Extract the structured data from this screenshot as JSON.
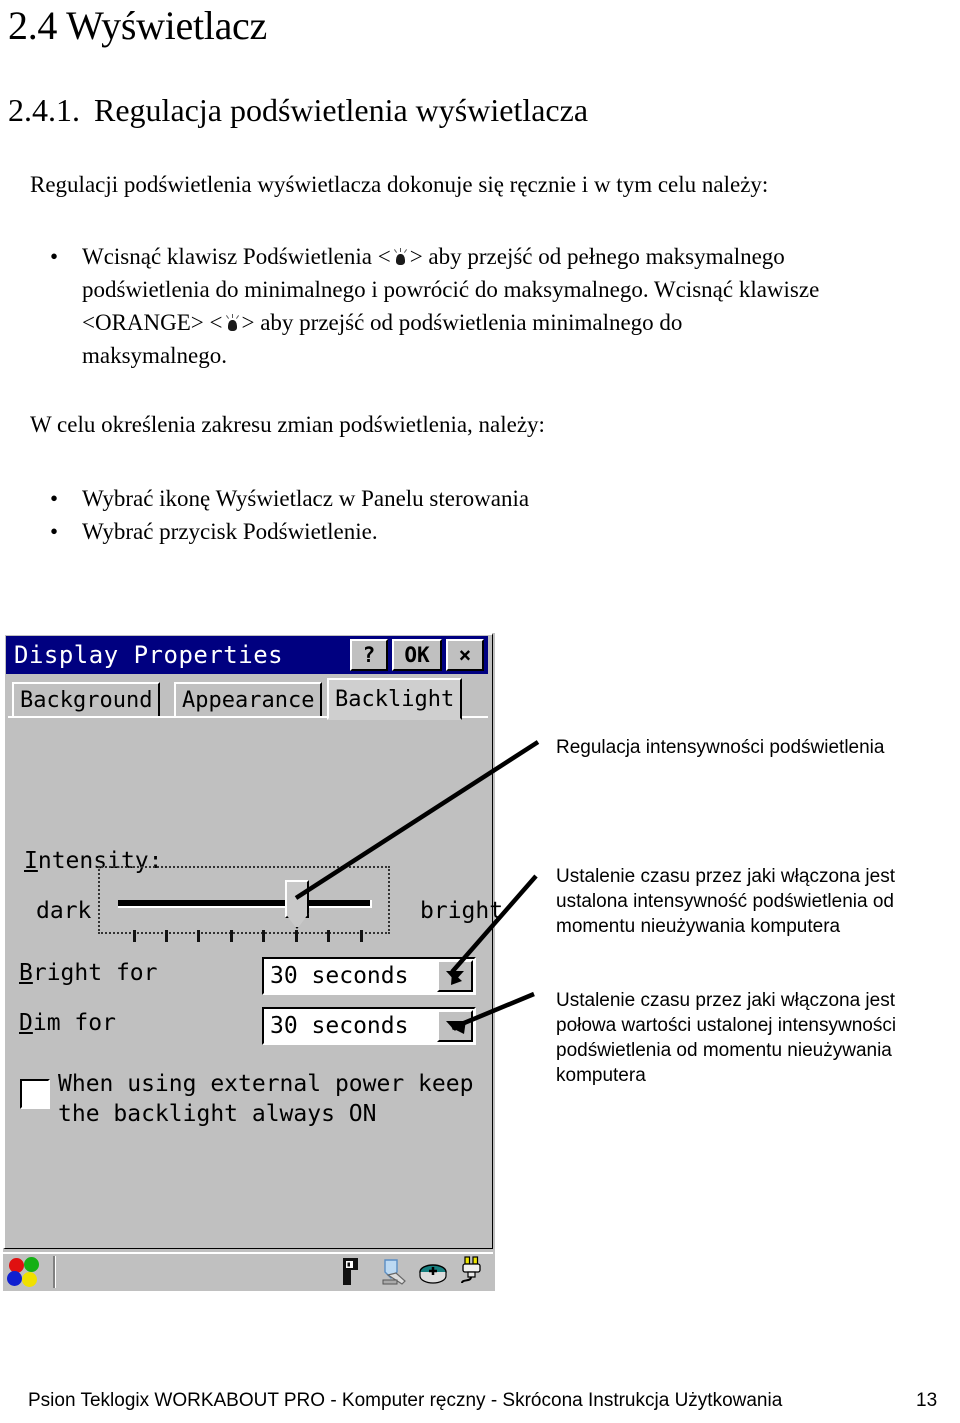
{
  "document": {
    "heading_1": "2.4 Wyświetlacz",
    "heading_2_number": "2.4.1.",
    "heading_2_text": "Regulacja podświetlenia wyświetlacza",
    "intro_paragraph": "Regulacji podświetlenia wyświetlacza dokonuje się ręcznie i w tym celu należy:",
    "bullet_1_part_a": "Wcisnąć klawisz Podświetlenia <",
    "bullet_1_part_b": "> aby przejść od pełnego maksymalnego",
    "bullet_1_line_2": "podświetlenia do minimalnego i powrócić do maksymalnego. Wcisnąć klawisze",
    "bullet_1_line_3_a": "<ORANGE> <",
    "bullet_1_line_3_b": "> aby przejść od podświetlenia minimalnego do",
    "bullet_1_line_4": "maksymalnego.",
    "paragraph_2": "W celu określenia zakresu zmian podświetlenia, należy:",
    "bullet_2": "Wybrać ikonę Wyświetlacz w Panelu sterowania",
    "bullet_3": "Wybrać przycisk Podświetlenie.",
    "bullet_marker": "•"
  },
  "dialog": {
    "title": "Display Properties",
    "titlebar_buttons": [
      {
        "name": "help",
        "label": "?"
      },
      {
        "name": "ok",
        "label": "OK"
      },
      {
        "name": "close",
        "label": "×"
      }
    ],
    "tabs": [
      {
        "label": "Background",
        "active": false
      },
      {
        "label": "Appearance",
        "active": false
      },
      {
        "label": "Backlight",
        "active": true
      }
    ],
    "intensity_label": "Intensity:",
    "dark_label": "dark",
    "bright_label": "bright",
    "slider": {
      "min_value": 0,
      "max_value": 7,
      "value": 5,
      "tick_count": 8
    },
    "bright_for_label": "Bright for",
    "bright_for_value": "30 seconds",
    "dim_for_label": "Dim for",
    "dim_for_value": "30 seconds",
    "checkbox_checked": false,
    "checkbox_line_1": "When using external power keep",
    "checkbox_line_2": "the backlight always ON",
    "taskbar": {
      "start_icon": "windows-ce-flag-icon",
      "tray_icons": [
        "keyboard-icon",
        "stylus-icon",
        "modem-icon",
        "power-plug-icon"
      ]
    }
  },
  "annotations": [
    {
      "id": "intensity",
      "lines": [
        "Regulacja intensywności podświetlenia"
      ]
    },
    {
      "id": "bright-for",
      "lines": [
        "Ustalenie czasu przez jaki włączona jest",
        "ustalona intensywność podświetlenia od",
        "momentu nieużywania komputera"
      ]
    },
    {
      "id": "dim-for",
      "lines": [
        "Ustalenie czasu przez jaki włączona jest",
        "połowa wartości ustalonej intensywności",
        "podświetlenia od momentu nieużywania",
        "komputera"
      ]
    }
  ],
  "footer": {
    "text": "Psion Teklogix WORKABOUT PRO - Komputer ręczny - Skrócona Instrukcja Użytkowania",
    "page_number": "13"
  },
  "colors": {
    "titlebar": "#000080",
    "dialog_face": "#c0c0c0",
    "text": "#000000",
    "field_background": "#ffffff"
  }
}
